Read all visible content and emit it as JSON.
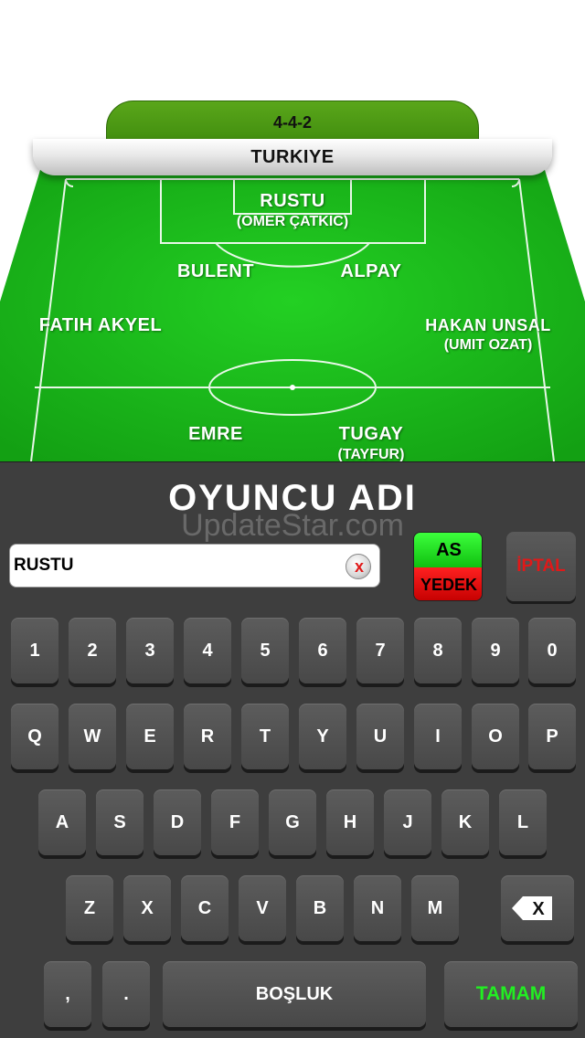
{
  "field": {
    "formation": "4-4-2",
    "team": "TURKIYE",
    "players": [
      {
        "name": "RUSTU",
        "sub": "(OMER ÇATKIC)"
      },
      {
        "name": "BULENT",
        "sub": ""
      },
      {
        "name": "ALPAY",
        "sub": ""
      },
      {
        "name": "FATIH AKYEL",
        "sub": ""
      },
      {
        "name": "HAKAN UNSAL",
        "sub": "(UMIT OZAT)"
      },
      {
        "name": "EMRE",
        "sub": ""
      },
      {
        "name": "TUGAY",
        "sub": "(TAYFUR)"
      }
    ]
  },
  "panel": {
    "title": "OYUNCU ADI",
    "watermark": "UpdateStar.com",
    "input_value": "RUSTU",
    "clear_icon": "x",
    "as_label": "AS",
    "yedek_label": "YEDEK",
    "cancel_label": "İPTAL"
  },
  "keyboard": {
    "row1": [
      "1",
      "2",
      "3",
      "4",
      "5",
      "6",
      "7",
      "8",
      "9",
      "0"
    ],
    "row2": [
      "Q",
      "W",
      "E",
      "R",
      "T",
      "Y",
      "U",
      "I",
      "O",
      "P"
    ],
    "row3": [
      "A",
      "S",
      "D",
      "F",
      "G",
      "H",
      "J",
      "K",
      "L"
    ],
    "row4": [
      "Z",
      "X",
      "C",
      "V",
      "B",
      "N",
      "M"
    ],
    "backspace_icon": "X",
    "comma": ",",
    "period": ".",
    "space_label": "BOŞLUK",
    "ok_label": "TAMAM"
  },
  "colors": {
    "pitch": "#1fb51f",
    "panel": "#3e3e3e",
    "ok_text": "#22ee22",
    "cancel_text": "#e01919",
    "as_bg": "#22dd22",
    "yedek_bg": "#dd1111"
  }
}
